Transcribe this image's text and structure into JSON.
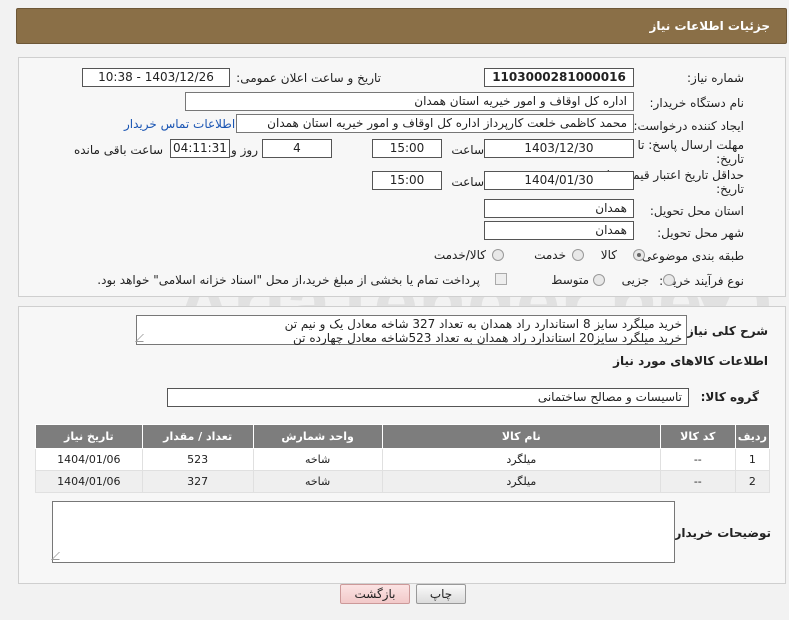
{
  "header": {
    "title": "جزئیات اطلاعات نیاز"
  },
  "form": {
    "need_number_label": "شماره نیاز:",
    "need_number": "1103000281000016",
    "announce_label": "تاریخ و ساعت اعلان عمومی:",
    "announce_value": "1403/12/26 - 10:38",
    "buyer_org_label": "نام دستگاه خریدار:",
    "buyer_org": "اداره کل اوقاف و امور خیریه استان همدان",
    "creator_label": "ایجاد کننده درخواست:",
    "creator": "محمد کاظمی خلعت کارپرداز اداره کل اوقاف و امور خیریه استان همدان",
    "contact_link": "اطلاعات تماس خریدار",
    "deadline_label_1": "مهلت ارسال پاسخ: تا",
    "deadline_label_2": "تاریخ:",
    "deadline_date": "1403/12/30",
    "time_label": "ساعت",
    "deadline_time": "15:00",
    "days_value": "4",
    "days_label": "روز و",
    "remaining_time": "04:11:31",
    "remaining_label": "ساعت باقی مانده",
    "validity_label_1": "حداقل تاریخ اعتبار قیمت: تا",
    "validity_label_2": "تاریخ:",
    "validity_date": "1404/01/30",
    "validity_time": "15:00",
    "province_label": "استان محل تحویل:",
    "province": "همدان",
    "city_label": "شهر محل تحویل:",
    "city": "همدان",
    "category_label": "طبقه بندی موضوعی:",
    "category_options": [
      "کالا",
      "خدمت",
      "کالا/خدمت"
    ],
    "process_label": "نوع فرآیند خرید :",
    "process_options": [
      "جزیی",
      "متوسط"
    ],
    "payment_note": "پرداخت تمام یا بخشی از مبلغ خرید،از محل \"اسناد خزانه اسلامی\" خواهد بود."
  },
  "details": {
    "summary_label": "شرح کلی نیاز:",
    "summary_line1": "خرید میلگرد سایز 8 استاندارد راد همدان به تعداد 327 شاخه معادل یک و نیم تن",
    "summary_line2": "خرید میلگرد سایز20 استاندارد راد همدان به تعداد 523شاخه معادل چهارده تن",
    "goods_info_title": "اطلاعات کالاهای مورد نیاز",
    "goods_group_label": "گروه کالا:",
    "goods_group": "تاسیسات و مصالح ساختمانی",
    "table": {
      "headers": [
        "ردیف",
        "کد کالا",
        "نام کالا",
        "واحد شمارش",
        "تعداد / مقدار",
        "تاریخ نیاز"
      ],
      "rows": [
        [
          "1",
          "--",
          "میلگرد",
          "شاخه",
          "523",
          "1404/01/06"
        ],
        [
          "2",
          "--",
          "میلگرد",
          "شاخه",
          "327",
          "1404/01/06"
        ]
      ]
    },
    "buyer_notes_label": "توضیحات خریدار:"
  },
  "buttons": {
    "print": "چاپ",
    "back": "بازگشت"
  },
  "watermark": {
    "text": "AriaTender.net"
  },
  "colors": {
    "header_bg": "#8a6f47",
    "table_header_bg": "#7d7d7d",
    "link": "#1a55b3",
    "back_button_bg": "#f7d7d7"
  }
}
